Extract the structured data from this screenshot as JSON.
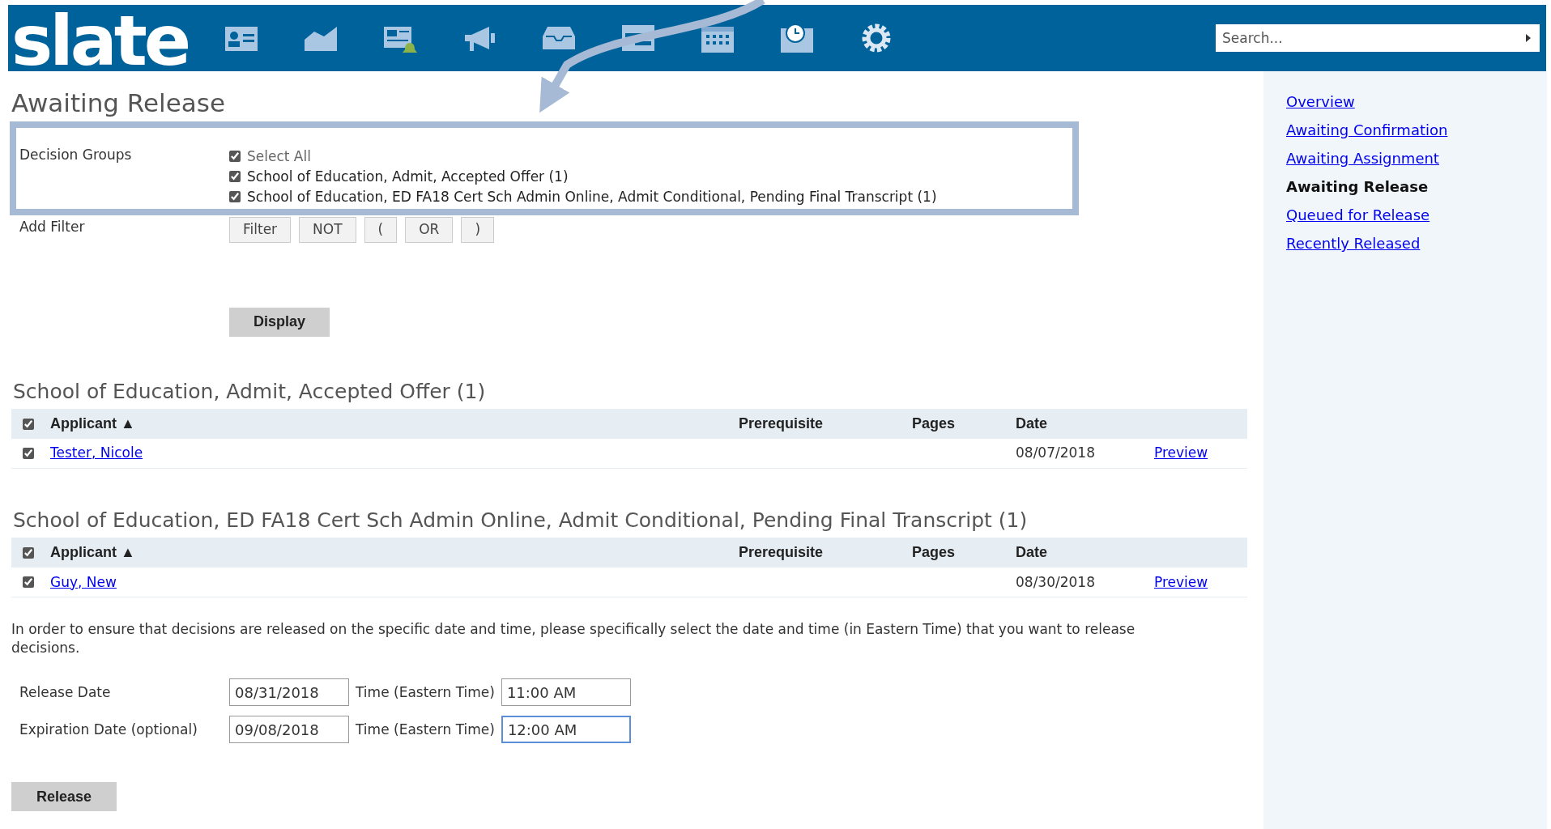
{
  "header": {
    "logo": "slate",
    "search": {
      "placeholder": "Search..."
    }
  },
  "page_title": "Awaiting Release",
  "filters": {
    "decision_groups_label": "Decision Groups",
    "options": [
      {
        "label": "Select All",
        "checked": true,
        "kind": "all"
      },
      {
        "label": "School of Education, Admit, Accepted Offer (1)",
        "checked": true,
        "kind": "group"
      },
      {
        "label": "School of Education, ED FA18 Cert Sch Admin Online, Admit Conditional, Pending Final Transcript (1)",
        "checked": true,
        "kind": "group"
      }
    ],
    "add_filter_label": "Add Filter",
    "filter_buttons": [
      "Filter",
      "NOT",
      "(",
      "OR",
      ")"
    ],
    "display_button": "Display"
  },
  "sections": [
    {
      "title": "School of Education, Admit, Accepted Offer (1)",
      "header_checked": true,
      "columns": [
        "Applicant ▲",
        "Prerequisite",
        "Pages",
        "Date"
      ],
      "rows": [
        {
          "checked": true,
          "applicant": "Tester, Nicole",
          "date": "08/07/2018",
          "action": "Preview"
        }
      ]
    },
    {
      "title": "School of Education, ED FA18 Cert Sch Admin Online, Admit Conditional, Pending Final Transcript (1)",
      "header_checked": true,
      "columns": [
        "Applicant ▲",
        "Prerequisite",
        "Pages",
        "Date"
      ],
      "rows": [
        {
          "checked": true,
          "applicant": "Guy, New",
          "date": "08/30/2018",
          "action": "Preview"
        }
      ]
    }
  ],
  "notice": "In order to ensure that decisions are released on the specific date and time, please specifically select the date and time (in Eastern Time) that you want to release decisions.",
  "release_form": [
    {
      "label": "Release Date",
      "date": "08/31/2018",
      "time_label": "Time (Eastern Time)",
      "time": "11:00 AM",
      "focused": false
    },
    {
      "label": "Expiration Date (optional)",
      "date": "09/08/2018",
      "time_label": "Time (Eastern Time)",
      "time": "12:00 AM",
      "focused": true
    }
  ],
  "release_button": "Release",
  "sidebar": {
    "items": [
      {
        "label": "Overview",
        "selected": false
      },
      {
        "label": "Awaiting Confirmation",
        "selected": false
      },
      {
        "label": "Awaiting Assignment",
        "selected": false
      },
      {
        "label": "Awaiting Release",
        "selected": true
      },
      {
        "label": "Queued for Release",
        "selected": false
      },
      {
        "label": "Recently Released",
        "selected": false
      }
    ]
  }
}
